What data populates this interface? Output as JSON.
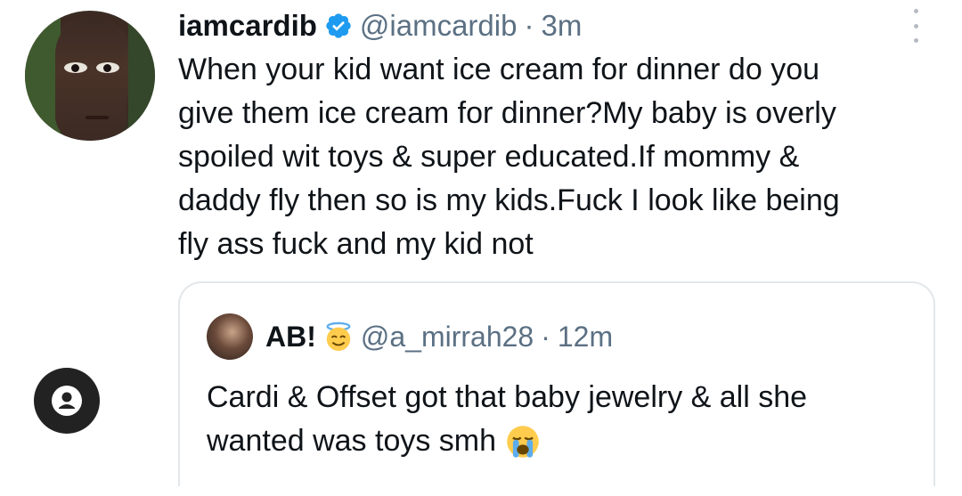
{
  "tweet": {
    "display_name": "iamcardib",
    "handle": "@iamcardib",
    "separator": "·",
    "time": "3m",
    "text_lines": [
      "When your kid want ice cream for dinner do you",
      "give them ice cream for dinner?My baby is overly",
      "spoiled wit toys & super educated.If mommy &",
      "daddy fly then so is my kids.Fuck I look like being",
      "fly ass fuck and my kid not"
    ],
    "avatar_icon": "profile-photo",
    "verified_icon": "verified-badge-icon",
    "more_icon": "more-vertical-icon"
  },
  "quote": {
    "display_name": "AB!",
    "name_emoji": "smiling-face-with-halo",
    "handle": "@a_mirrah28",
    "separator": "·",
    "time": "12m",
    "text_lines": [
      "Cardi & Offset got that baby jewelry & all she",
      "wanted was toys smh"
    ],
    "text_emoji": "loudly-crying-face"
  },
  "overlay": {
    "fab_icon": "user-profile-icon"
  },
  "colors": {
    "text": "#0f1419",
    "secondary": "#5b7083",
    "verified": "#1d9bf0",
    "border": "#e3e7ea",
    "fab": "#222222"
  }
}
